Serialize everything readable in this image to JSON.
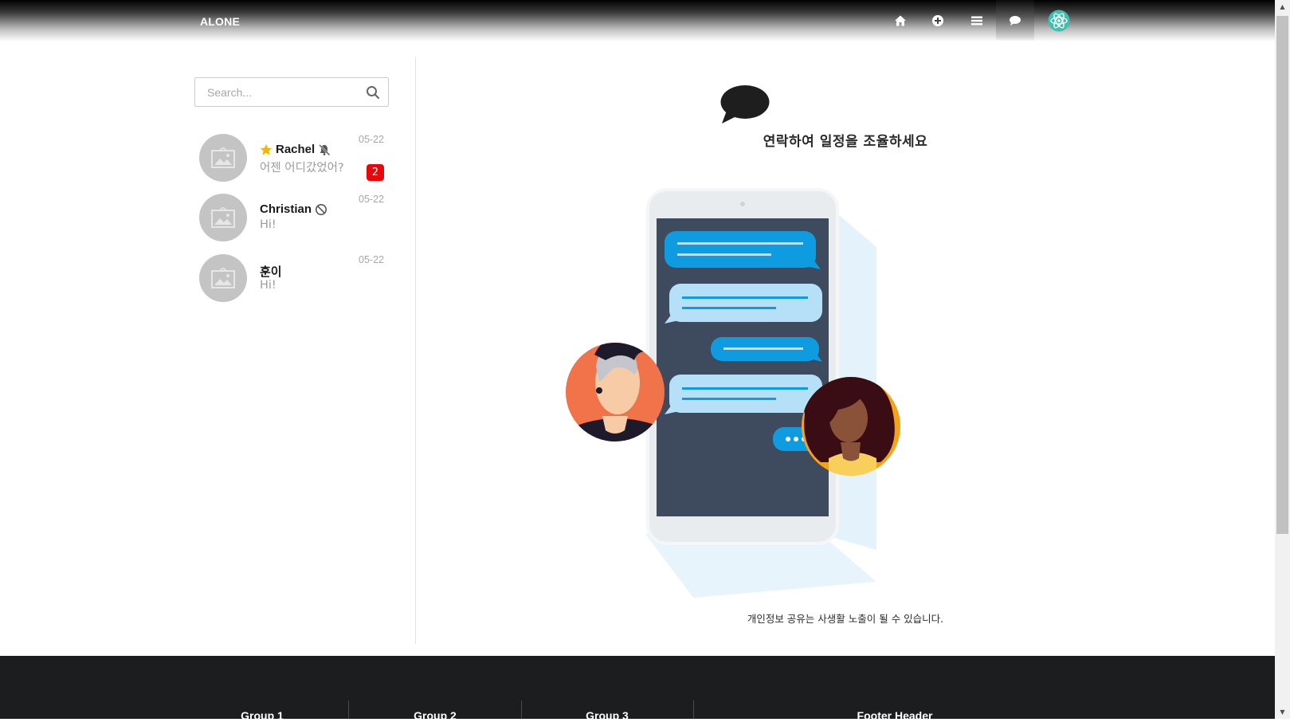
{
  "navbar": {
    "brand": "ALONE",
    "icons": [
      "home-icon",
      "plus-circle-icon",
      "list-icon",
      "chat-icon",
      "react-logo-icon"
    ],
    "active": "chat-icon",
    "accent_color": "#61dafb"
  },
  "sidebar": {
    "search_placeholder": "Search...",
    "chats": [
      {
        "name": "Rachel",
        "preview": "어젠 어디갔었어?",
        "date": "05-22",
        "unread": "2",
        "starred": true,
        "muted": true,
        "blocked": false
      },
      {
        "name": "Christian",
        "preview": "Hi!",
        "date": "05-22",
        "unread": "",
        "starred": false,
        "muted": false,
        "blocked": true
      },
      {
        "name": "훈이",
        "preview": "Hi!",
        "date": "05-22",
        "unread": "",
        "starred": false,
        "muted": false,
        "blocked": false
      }
    ]
  },
  "main": {
    "headline": "연락하여 일정을 조율하세요",
    "caption": "개인정보 공유는 사생활 노출이 될 수 있습니다."
  },
  "footer": {
    "groups": [
      "Group 1",
      "Group 2",
      "Group 3",
      "Footer Header"
    ]
  },
  "colors": {
    "badge": "#e8070b",
    "star": "#f5b400",
    "footer_bg": "#1c1d1f",
    "message_blue": "#0f9be0",
    "message_light": "#b6e0f7"
  }
}
